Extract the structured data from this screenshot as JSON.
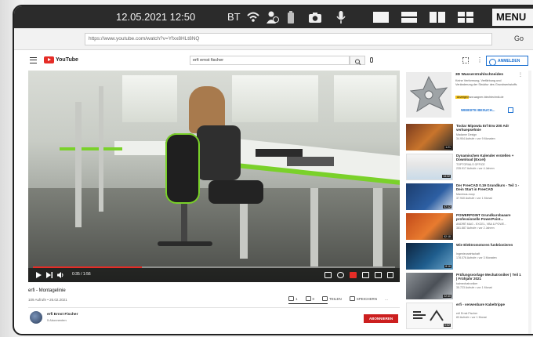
{
  "status_bar": {
    "datetime": "12.05.2021 12:50",
    "bt": "BT",
    "menu": "MENU",
    "icons": [
      "wifi-icon",
      "battery-icon",
      "phone-icon",
      "camera-icon",
      "microphone-icon"
    ]
  },
  "browser": {
    "url": "https://www.youtube.com/watch?v=Yfxx8HLt8NQ",
    "go_label": "Go"
  },
  "youtube": {
    "logo_text": "YouTube",
    "search_value": "erfi ernst fischer",
    "sign_in": "ANMELDEN"
  },
  "video": {
    "time": "0:35 / 1:56",
    "progress": 0.3,
    "title": "erfi - Montagelinie",
    "meta": "109 Aufrufe • 26.02.2021",
    "actions": {
      "likes": "1",
      "dislikes": "0",
      "share": "TEILEN",
      "save": "SPEICHERN",
      "more": "..."
    }
  },
  "channel": {
    "name": "erfi Ernst Fischer",
    "subs": "5 Abonnenten",
    "subscribe": "ABONNIEREN"
  },
  "ad": {
    "title": "3D Wasserstrahlschneiden",
    "desc": "Keine Verformung, Verfärbung und Veränderung der Struktur des Grundwerkstoffs",
    "badge": "Anzeige",
    "url": "www.wagner-blechtechnik.de",
    "button": "WEBSITE BESUCH..."
  },
  "recommendations": [
    {
      "title": "Toolar Mipowta Erf Erw 200 Adr verhuepsehnie",
      "channel": "Madame Design",
      "meta": "34.904 Aufrufe • vor 9 Monaten",
      "duration": "1:21"
    },
    {
      "title": "Dynamischen Kalender erstellen + Download (Excel)",
      "channel": "TOPTORIALS OFFICE",
      "meta": "235.917 Aufrufe • vor 4 Jahren",
      "duration": "14:32"
    },
    {
      "title": "Der FreeCAD 0.19 Grundkurs - Teil 1 - Dein Start in FreeCAD",
      "channel": "Maximus-noop",
      "meta": "37.940 Aufrufe • vor 1 Monat",
      "duration": "47:12"
    },
    {
      "title": "POWERPOINT Grundkursbaaare professionelle PowerPoint...",
      "channel": "ANDRÉ MAG - EXCEL, VBA & POWE...",
      "meta": "381.887 Aufrufe • vor 2 Jahren",
      "duration": "52:18"
    },
    {
      "title": "Wie Elektromotoren funktionieren",
      "channel": "Ingenieurwirtschaft",
      "meta": "178.076 Aufrufe • vor 3 Monaten",
      "duration": "8:16"
    },
    {
      "title": "Prüfungsvorlage Mechatroniker | Teil 1 | Frühjahr 2021",
      "channel": "kaimechatroniker",
      "meta": "35.723 Aufrufe • vor 1 Monat",
      "duration": "22:40"
    },
    {
      "title": "erfi - verwenbare Kabeltrippe",
      "channel": "erfi Ernst Fischer",
      "meta": "83 Aufrufe • vor 1 Monat",
      "duration": "0:52"
    }
  ]
}
